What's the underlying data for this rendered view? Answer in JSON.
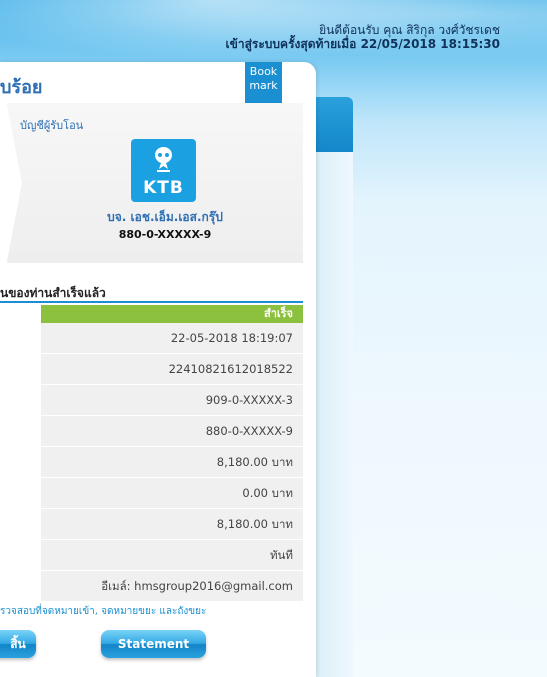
{
  "header": {
    "welcome_line": "ยินดีต้อนรับ คุณ สิริกุล วงศ์วัชรเดช",
    "last_login_line": "เข้าสู่ระบบครั้งสุดท้ายเมื่อ 22/05/2018 18:15:30"
  },
  "card": {
    "title": "บร้อย",
    "bookmark_line1": "Book",
    "bookmark_line2": "mark"
  },
  "recipient": {
    "label": "บัญชีผู้รับโอน",
    "bank_logo_text": "KTB",
    "name": "บจ. เอช.เอ็ม.เอส.กรุ๊ป",
    "account": "880-0-XXXXX-9"
  },
  "result": {
    "heading": "ินของท่านสำเร็จแล้ว",
    "status": "สำเร็จ",
    "rows": [
      "22-05-2018 18:19:07",
      "22410821612018522",
      "909-0-XXXXX-3",
      "880-0-XXXXX-9",
      "8,180.00 บาท",
      "0.00 บาท",
      "8,180.00 บาท",
      "ทันที",
      "อีเมล์: hmsgroup2016@gmail.com"
    ]
  },
  "note": "รวจสอบที่จดหมายเข้า, จดหมายขยะ และถังขยะ",
  "buttons": {
    "left_label": "สิ้น",
    "statement_label": "Statement"
  },
  "colors": {
    "accent": "#1a8fd2",
    "success": "#8cc13f",
    "title": "#2e6fb3"
  }
}
